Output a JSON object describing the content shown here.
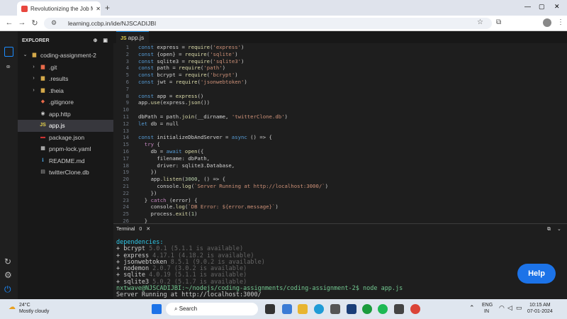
{
  "browser": {
    "tab_title": "Revolutionizing the Job Market",
    "url": "learning.ccbp.in/ide/NJSCADIJBI"
  },
  "explorer": {
    "header": "EXPLORER",
    "folder": "coding-assignment-2",
    "items": [
      ".git",
      ".results",
      ".theia",
      ".gitignore",
      "app.http",
      "app.js",
      "package.json",
      "pnpm-lock.yaml",
      "README.md",
      "twitterClone.db"
    ]
  },
  "editor": {
    "tab": "app.js",
    "lines": [
      {
        "n": "1",
        "t": "const express = require('express')"
      },
      {
        "n": "2",
        "t": "const {open} = require('sqlite')"
      },
      {
        "n": "3",
        "t": "const sqlite3 = require('sqlite3')"
      },
      {
        "n": "4",
        "t": "const path = require('path')"
      },
      {
        "n": "5",
        "t": "const bcrypt = require('bcrypt')"
      },
      {
        "n": "6",
        "t": "const jwt = require('jsonwebtoken')"
      },
      {
        "n": "7",
        "t": ""
      },
      {
        "n": "8",
        "t": "const app = express()"
      },
      {
        "n": "9",
        "t": "app.use(express.json())"
      },
      {
        "n": "10",
        "t": ""
      },
      {
        "n": "11",
        "t": "dbPath = path.join(__dirname, 'twitterClone.db')"
      },
      {
        "n": "12",
        "t": "let db = null"
      },
      {
        "n": "13",
        "t": ""
      },
      {
        "n": "14",
        "t": "const initializeDbAndServer = async () => {"
      },
      {
        "n": "15",
        "t": "  try {"
      },
      {
        "n": "16",
        "t": "    db = await open({"
      },
      {
        "n": "17",
        "t": "      filename: dbPath,"
      },
      {
        "n": "18",
        "t": "      driver: sqlite3.Database,"
      },
      {
        "n": "19",
        "t": "    })"
      },
      {
        "n": "20",
        "t": "    app.listen(3000, () => {"
      },
      {
        "n": "21",
        "t": "      console.log(`Server Running at http://localhost:3000/`)"
      },
      {
        "n": "22",
        "t": "    })"
      },
      {
        "n": "23",
        "t": "  } catch (error) {"
      },
      {
        "n": "24",
        "t": "    console.log(`DB Error: ${error.message}`)"
      },
      {
        "n": "25",
        "t": "    process.exit(1)"
      },
      {
        "n": "26",
        "t": "  }"
      }
    ]
  },
  "terminal": {
    "tab": "Terminal",
    "count": "0",
    "deps_header": "dependencies:",
    "deps": [
      {
        "name": "+ bcrypt",
        "ver": " 5.0.1 (5.1.1 is available)"
      },
      {
        "name": "+ express",
        "ver": " 4.17.1 (4.18.2 is available)"
      },
      {
        "name": "+ jsonwebtoken",
        "ver": " 8.5.1 (9.0.2 is available)"
      },
      {
        "name": "+ nodemon",
        "ver": " 2.0.7 (3.0.2 is available)"
      },
      {
        "name": "+ sqlite",
        "ver": " 4.0.19 (5.1.1 is available)"
      },
      {
        "name": "+ sqlite3",
        "ver": " 5.0.2 (5.1.7 is available)"
      }
    ],
    "prompt": "nxtwave@NJSCADIJBI:~/nodejs/coding-assignments/coding-assignment-2$ node app.js",
    "output": "Server Running at http://localhost:3000/"
  },
  "help_label": "Help",
  "taskbar": {
    "weather_temp": "24°C",
    "weather_desc": "Mostly cloudy",
    "search": "Search",
    "lang1": "ENG",
    "lang2": "IN",
    "time": "10:15 AM",
    "date": "07-01-2024"
  },
  "colors": {
    "accent": "#0078d4",
    "help": "#1c73e8"
  }
}
